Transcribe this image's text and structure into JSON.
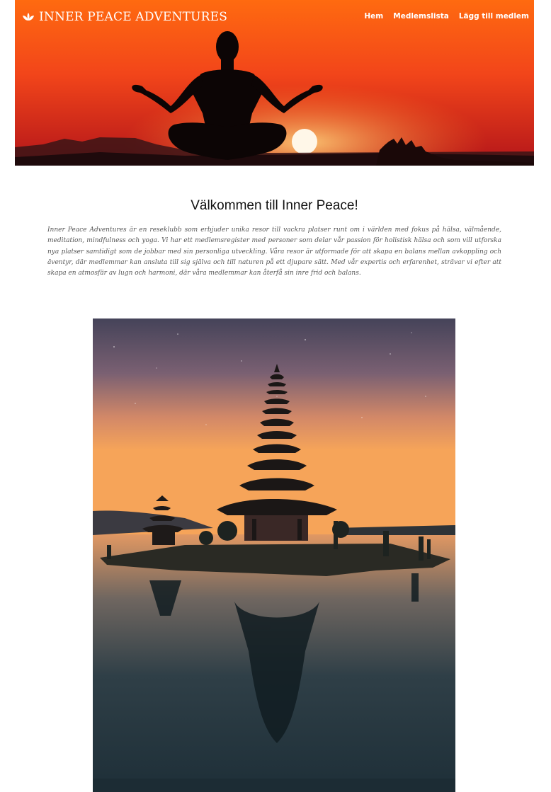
{
  "header": {
    "brand": "INNER PEACE ADVENTURES",
    "brand_icon": "lotus-icon",
    "nav": [
      {
        "label": "Hem"
      },
      {
        "label": "Medlemslista"
      },
      {
        "label": "Lägg till medlem"
      }
    ],
    "hero_image": "yoga-silhouette-sunset"
  },
  "main": {
    "title": "Välkommen till Inner Peace!",
    "description": "Inner Peace Adventures är en reseklubb som erbjuder unika resor till vackra platser runt om i världen med fokus på hälsa, välmående, meditation, mindfulness och yoga. Vi har ett medlemsregister med personer som delar vår passion för holistisk hälsa och som vill utforska nya platser samtidigt som de jobbar med sin personliga utveckling. Våra resor är utformade för att skapa en balans mellan avkoppling och äventyr, där medlemmar kan ansluta till sig själva och till naturen på ett djupare sätt. Med vår expertis och erfarenhet, strävar vi efter att skapa en atmosfär av lugn och harmoni, där våra medlemmar kan återfå sin inre frid och balans.",
    "feature_image": "temple-on-lake-at-dusk"
  },
  "colors": {
    "hero_top": "#ff5c13",
    "hero_bottom": "#c61a10",
    "sky_top": "#4a4660",
    "sky_bottom": "#f6a45c",
    "water": "#23343d"
  }
}
